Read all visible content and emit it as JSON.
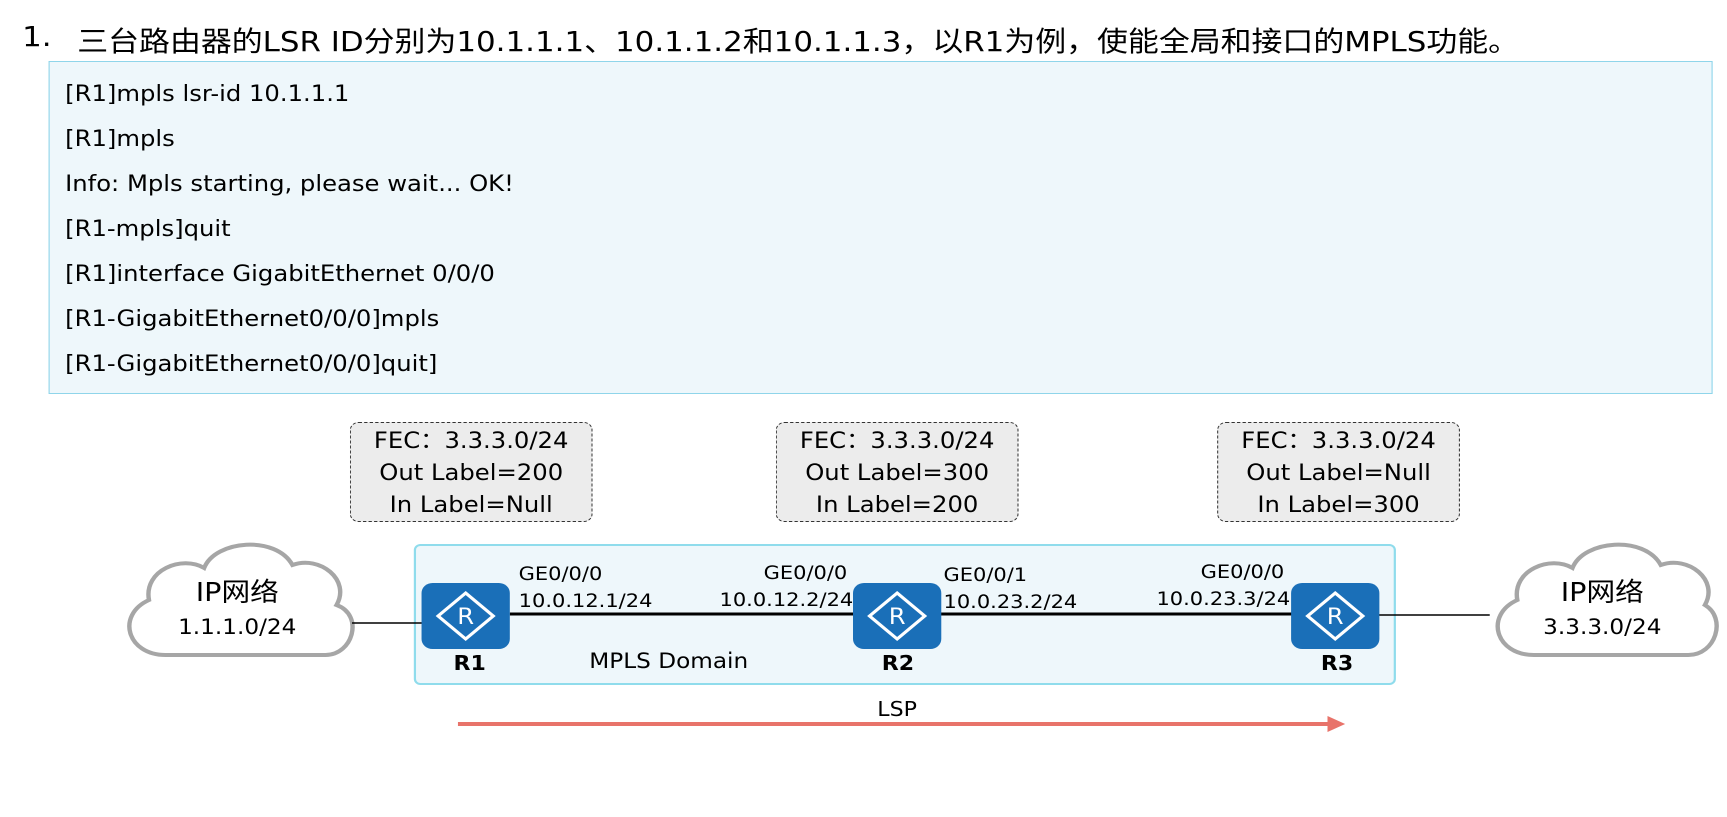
{
  "instruction": {
    "number": "1.",
    "text": "三台路由器的LSR ID分别为10.1.1.1、10.1.1.2和10.1.1.3，以R1为例，使能全局和接口的MPLS功能。"
  },
  "code_lines": [
    "[R1]mpls lsr-id 10.1.1.1",
    "[R1]mpls",
    "Info: Mpls starting, please wait... OK!",
    "[R1-mpls]quit",
    "[R1]interface GigabitEthernet 0/0/0",
    "[R1-GigabitEthernet0/0/0]mpls",
    "[R1-GigabitEthernet0/0/0]quit]"
  ],
  "fec_tables": [
    {
      "fec": "FEC：3.3.3.0/24",
      "out": "Out Label=200",
      "in": "In Label=Null"
    },
    {
      "fec": "FEC：3.3.3.0/24",
      "out": "Out Label=300",
      "in": "In Label=200"
    },
    {
      "fec": "FEC：3.3.3.0/24",
      "out": "Out Label=Null",
      "in": "In Label=300"
    }
  ],
  "clouds": [
    {
      "title": "IP网络",
      "subnet": "1.1.1.0/24"
    },
    {
      "title": "IP网络",
      "subnet": "3.3.3.0/24"
    }
  ],
  "routers": [
    {
      "name": "R1",
      "glyph": "R"
    },
    {
      "name": "R2",
      "glyph": "R"
    },
    {
      "name": "R3",
      "glyph": "R"
    }
  ],
  "interfaces": {
    "r1_ge000": "GE0/0/0",
    "r1_ip": "10.0.12.1/24",
    "r2_ge000": "GE0/0/0",
    "r2_ip_left": "10.0.12.2/24",
    "r2_ge001": "GE0/0/1",
    "r2_ip_right": "10.0.23.2/24",
    "r3_ge000": "GE0/0/0",
    "r3_ip": "10.0.23.3/24"
  },
  "domain_label": "MPLS Domain",
  "lsp_label": "LSP",
  "colors": {
    "router_blue": "#1a6fb8",
    "lsp_arrow": "#e8736a",
    "code_bg": "#eef7fb",
    "code_border": "#8fd5ea"
  }
}
